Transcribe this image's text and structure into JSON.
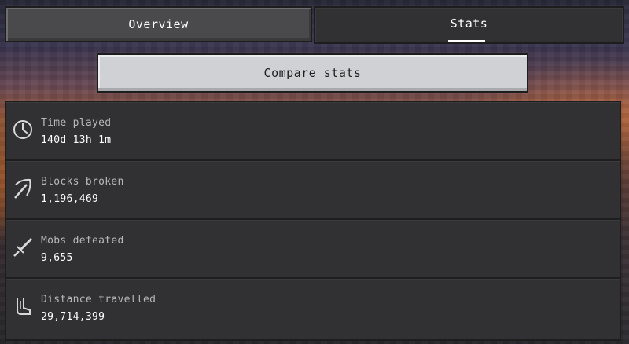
{
  "tabs": {
    "overview_label": "Overview",
    "stats_label": "Stats",
    "active": "Stats"
  },
  "compare_button_label": "Compare stats",
  "stats": [
    {
      "label": "Time played",
      "value": "140d 13h 1m",
      "icon": "clock-icon"
    },
    {
      "label": "Blocks broken",
      "value": "1,196,469",
      "icon": "pickaxe-icon"
    },
    {
      "label": "Mobs defeated",
      "value": "9,655",
      "icon": "sword-icon"
    },
    {
      "label": "Distance travelled",
      "value": "29,714,399",
      "icon": "boots-icon"
    }
  ],
  "colors": {
    "panel": "#313133",
    "tab_inactive": "#4a4a4c",
    "button": "#d0d1d4",
    "border": "#1d1d1e",
    "label_text": "#b8b8ba",
    "value_text": "#ffffff"
  }
}
